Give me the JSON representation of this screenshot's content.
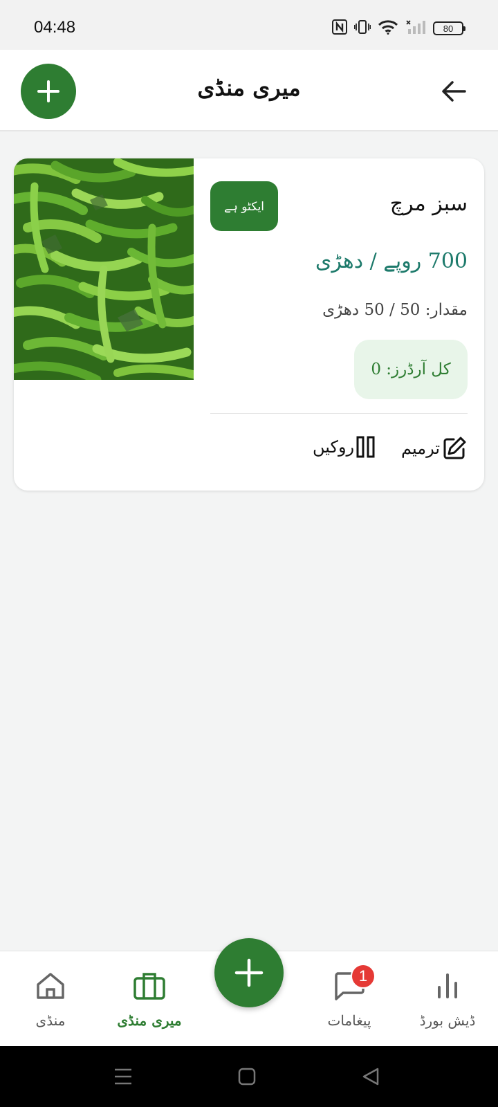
{
  "status_bar": {
    "time": "04:48",
    "battery": "80",
    "icons": [
      "nfc-icon",
      "vibrate-icon",
      "wifi-icon",
      "signal-icon",
      "battery-icon"
    ]
  },
  "header": {
    "title": "میری منڈی",
    "add_icon": "plus-icon",
    "back_icon": "arrow-left-icon"
  },
  "listing": {
    "name": "سبز مرچ",
    "status": "ایکٹو ہے",
    "price": "700 روپے / دھڑی",
    "quantity": "مقدار: 50 / 50 دھڑی",
    "total_orders": "کل آرڈرز: 0",
    "actions": {
      "edit_label": "ترمیم",
      "pause_label": "روکیں"
    }
  },
  "bottom_nav": {
    "items": [
      {
        "label": "منڈی",
        "icon": "home-icon",
        "active": false
      },
      {
        "label": "میری منڈی",
        "icon": "briefcase-icon",
        "active": true
      },
      {
        "label": "پیغامات",
        "icon": "chat-icon",
        "badge": "1",
        "active": false
      },
      {
        "label": "ڈیش بورڈ",
        "icon": "bar-chart-icon",
        "active": false
      }
    ],
    "center_icon": "plus-icon"
  },
  "colors": {
    "primary": "#2e7d32",
    "price": "#1d7a6b",
    "orders_bg": "#e8f5e9",
    "badge": "#e53935",
    "background": "#f3f4f4"
  }
}
